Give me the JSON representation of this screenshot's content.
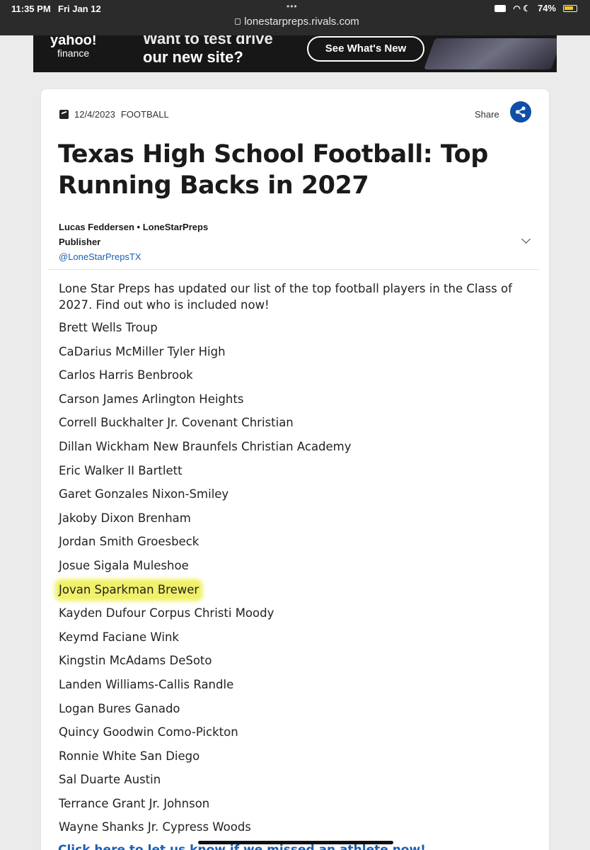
{
  "status_bar": {
    "time": "11:35 PM",
    "date": "Fri Jan 12",
    "url": "lonestarpreps.rivals.com",
    "battery": "74%"
  },
  "ad": {
    "logo_line1": "yahoo!",
    "logo_line2": "finance",
    "headline_line1": "Want to test drive",
    "headline_line2": "our new site?",
    "button": "See What's New"
  },
  "article": {
    "date": "12/4/2023",
    "category": "FOOTBALL",
    "share_label": "Share",
    "title": "Texas High School Football: Top Running Backs in 2027",
    "author": "Lucas Feddersen • LoneStarPreps",
    "author_role": "Publisher",
    "author_handle": "@LoneStarPrepsTX",
    "intro": "Lone Star Preps has updated our list of the top football players in the Class of 2027. Find out who is included now!",
    "players": [
      "Brett Wells Troup",
      "CaDarius McMiller Tyler High",
      "Carlos Harris Benbrook",
      "Carson James Arlington Heights",
      "Correll Buckhalter Jr. Covenant Christian",
      "Dillan Wickham New Braunfels Christian Academy",
      "Eric Walker II Bartlett",
      "Garet Gonzales Nixon-Smiley",
      "Jakoby Dixon Brenham",
      "Jordan Smith Groesbeck",
      "Josue Sigala Muleshoe",
      "Jovan Sparkman Brewer",
      "Kayden Dufour Corpus Christi Moody",
      "Keymd Faciane Wink",
      "Kingstin McAdams DeSoto",
      "Landen Williams-Callis Randle",
      "Logan Bures Ganado",
      "Quincy Goodwin Como-Pickton",
      "Ronnie White San Diego",
      "Sal Duarte Austin",
      "Terrance Grant Jr. Johnson",
      "Wayne Shanks Jr. Cypress Woods"
    ],
    "highlighted_index": 11,
    "footer_link": "Click here to let us know if we missed an athlete now!"
  },
  "colors": {
    "link": "#1a5fb4",
    "share_button": "#0f4fa8",
    "highlight": "#f0f06a"
  }
}
